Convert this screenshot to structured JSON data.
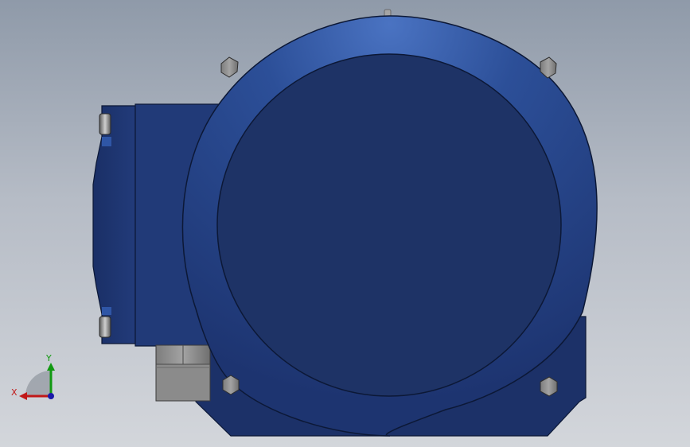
{
  "viewport": {
    "background_top": "#8f9aa9",
    "background_bottom": "#d3d6db"
  },
  "model": {
    "body_color": "#1f3670",
    "face_color": "#1e3366",
    "flange_highlight": "#3f67b4",
    "fitting_color": "#8a8a8a"
  },
  "triad": {
    "x_label": "X",
    "y_label": "Y",
    "x_color": "#c11818",
    "y_color": "#119911",
    "z_color": "#1a1aa8"
  }
}
